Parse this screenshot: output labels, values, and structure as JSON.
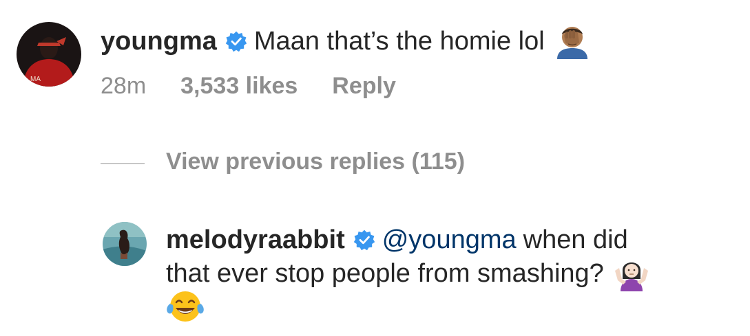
{
  "comment": {
    "username": "youngma",
    "text": "Maan that’s the homie lol",
    "emoji": "face-palm-emoji",
    "meta": {
      "time": "28m",
      "likes": "3,533 likes",
      "reply": "Reply"
    }
  },
  "replies_toggle": {
    "label": "View previous replies (115)"
  },
  "reply": {
    "username": "melodyraabbit",
    "mention": "@youngma",
    "text_line1": "when did",
    "text_line2": "that ever stop people from smashing?",
    "emojis": [
      "shrug-emoji",
      "tears-of-joy-emoji"
    ]
  },
  "colors": {
    "text": "#262626",
    "muted": "#8e8e8e",
    "mention": "#003569",
    "verified": "#3897f0"
  }
}
